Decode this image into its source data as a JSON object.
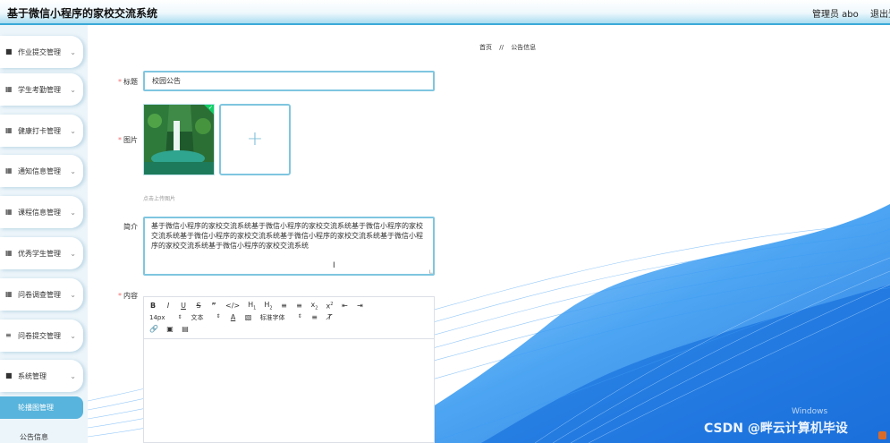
{
  "app": {
    "title": "基于微信小程序的家校交流系统",
    "user_label": "管理员 abo",
    "logout_label": "退出登录"
  },
  "sidebar": {
    "items": [
      {
        "label": "作业提交管理",
        "icon": "menu-icon"
      },
      {
        "label": "学生考勤管理",
        "icon": "grid-icon"
      },
      {
        "label": "健康打卡管理",
        "icon": "grid-icon"
      },
      {
        "label": "通知信息管理",
        "icon": "grid-icon"
      },
      {
        "label": "课程信息管理",
        "icon": "grid-icon"
      },
      {
        "label": "优秀学生管理",
        "icon": "grid-icon"
      },
      {
        "label": "问卷调查管理",
        "icon": "grid-icon"
      },
      {
        "label": "问卷提交管理",
        "icon": "list-icon"
      },
      {
        "label": "系统管理",
        "icon": "menu-icon"
      }
    ],
    "sub_active": "轮播图管理",
    "sub_item": "公告信息"
  },
  "breadcrumb": {
    "home": "首页",
    "separator": "//",
    "current": "公告信息"
  },
  "form": {
    "title_label": "标题",
    "title_value": "校园公告",
    "image_label": "图片",
    "upload_tip": "点击上传图片",
    "intro_label": "简介",
    "intro_value": "基于微信小程序的家校交流系统基于微信小程序的家校交流系统基于微信小程序的家校交流系统基于微信小程序的家校交流系统基于微信小程序的家校交流系统基于微信小程序的家校交流系统基于微信小程序的家校交流系统",
    "content_label": "内容"
  },
  "editor": {
    "font_size": "14px",
    "block_format": "文本",
    "font_family": "标准字体"
  },
  "watermark": {
    "windows": "Windows",
    "csdn": "CSDN @畔云计算机毕设"
  },
  "colors": {
    "accent": "#3aa9d8",
    "active_sub": "#58b4dc",
    "required": "#f56c6c",
    "wave": "#1e8ef0"
  }
}
